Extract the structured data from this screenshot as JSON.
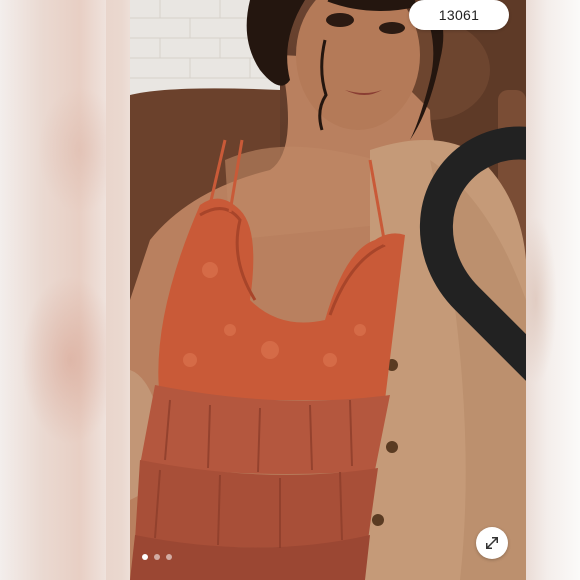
{
  "listing": {
    "like_count": "13061",
    "like_icon": "heart-outline-icon",
    "expand_icon": "expand-diagonal-icon",
    "carousel": {
      "total_images": 3,
      "active_index": 0
    }
  },
  "colors": {
    "top": "#c95a38",
    "cardigan": "#c59a78",
    "chair": "#6a4330",
    "skin": "#b9805f"
  }
}
